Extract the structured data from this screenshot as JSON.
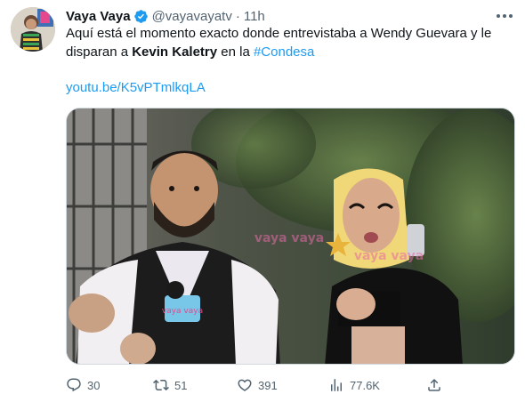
{
  "tweet": {
    "author_name": "Vaya Vaya",
    "handle": "@vayavayatv",
    "separator": "·",
    "time": "11h",
    "text_start": "Aquí está el momento exacto donde entrevistaba a Wendy Guevara y le disparan a ",
    "text_bold": "Kevin Kaletry",
    "text_mid": " en la ",
    "hashtag": "#Condesa",
    "link": "youtu.be/K5vPTmlkqLA",
    "media_watermark": "vaya vaya",
    "mic_label": "vaya vaya"
  },
  "actions": {
    "replies": "30",
    "retweets": "51",
    "likes": "391",
    "views": "77.6K"
  },
  "colors": {
    "accent": "#1d9bf0",
    "secondary_text": "#536471",
    "primary_text": "#0f1419",
    "border": "#cfd9de"
  },
  "icons": [
    "verified-badge-icon",
    "more-icon",
    "reply-icon",
    "retweet-icon",
    "like-icon",
    "views-icon",
    "share-icon"
  ]
}
